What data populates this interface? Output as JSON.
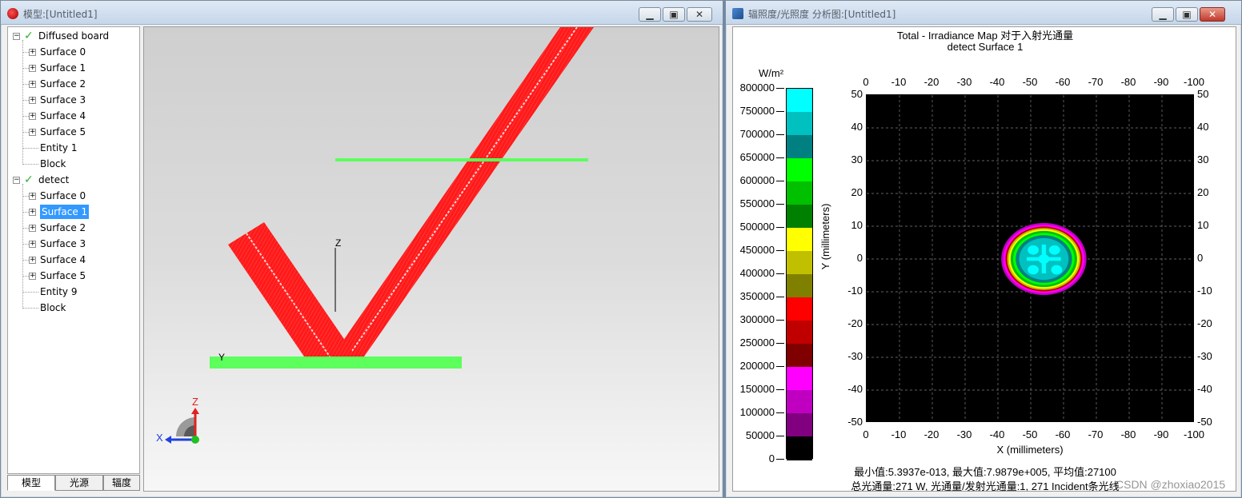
{
  "left_window": {
    "title": "模型:[Untitled1]",
    "tree": [
      {
        "label": "Diffused board",
        "level": 0,
        "checked": true
      },
      {
        "label": "Surface 0",
        "level": 1
      },
      {
        "label": "Surface 1",
        "level": 1
      },
      {
        "label": "Surface 2",
        "level": 1
      },
      {
        "label": "Surface 3",
        "level": 1
      },
      {
        "label": "Surface 4",
        "level": 1
      },
      {
        "label": "Surface 5",
        "level": 1
      },
      {
        "label": "Entity 1",
        "level": 1,
        "leaf": true
      },
      {
        "label": "Block",
        "level": 1,
        "leaf": true
      },
      {
        "label": "detect",
        "level": 0,
        "checked": true
      },
      {
        "label": "Surface 0",
        "level": 1
      },
      {
        "label": "Surface 1",
        "level": 1,
        "selected": true
      },
      {
        "label": "Surface 2",
        "level": 1
      },
      {
        "label": "Surface 3",
        "level": 1
      },
      {
        "label": "Surface 4",
        "level": 1
      },
      {
        "label": "Surface 5",
        "level": 1
      },
      {
        "label": "Entity 9",
        "level": 1,
        "leaf": true
      },
      {
        "label": "Block",
        "level": 1,
        "leaf": true
      }
    ],
    "tabs": [
      "模型",
      "光源",
      "辐度"
    ],
    "viewport": {
      "axis_z": "Z",
      "axis_y": "Y",
      "triad_z": "Z",
      "triad_x": "X",
      "ray_color": "#ff1a1a",
      "surface_color": "#5cff5c"
    }
  },
  "right_window": {
    "title": "辐照度/光照度 分析图:[Untitled1]",
    "plot_title_line1": "Total - Irradiance Map 对于入射光通量",
    "plot_title_line2": "detect Surface 1",
    "colorbar": {
      "unit": "W/m²",
      "tick_labels": [
        "800000",
        "750000",
        "700000",
        "650000",
        "600000",
        "550000",
        "500000",
        "450000",
        "400000",
        "350000",
        "300000",
        "250000",
        "200000",
        "150000",
        "100000",
        "50000",
        "0"
      ],
      "colors": [
        "#00ffff",
        "#00c0c0",
        "#008080",
        "#00ff00",
        "#00c000",
        "#008000",
        "#ffff00",
        "#c0c000",
        "#808000",
        "#ff0000",
        "#c00000",
        "#800000",
        "#ff00ff",
        "#c000c0",
        "#800080",
        "#000000"
      ]
    },
    "x_ticks": [
      "0",
      "-10",
      "-20",
      "-30",
      "-40",
      "-50",
      "-60",
      "-70",
      "-80",
      "-90",
      "-100"
    ],
    "y_ticks_left": [
      "50",
      "40",
      "30",
      "20",
      "10",
      "0",
      "-10",
      "-20",
      "-30",
      "-40",
      "-50"
    ],
    "y_ticks_right": [
      "50",
      "40",
      "30",
      "20",
      "10",
      "0",
      "-10",
      "-20",
      "-30",
      "-40",
      "-50"
    ],
    "x_label": "X (millimeters)",
    "y_label": "Y (millimeters)",
    "stats_line1": "最小值:5.3937e-013, 最大值:7.9879e+005, 平均值:27100",
    "stats_line2": "总光通量:271 W, 光通量/发射光通量:1, 271 Incident条光线",
    "watermark": "CSDN @zhoxiao2015"
  },
  "chart_data": {
    "type": "heatmap",
    "title": "Total - Irradiance Map 对于入射光通量",
    "subtitle": "detect Surface 1",
    "xlabel": "X (millimeters)",
    "ylabel": "Y (millimeters)",
    "xlim": [
      0,
      -100
    ],
    "ylim": [
      -50,
      50
    ],
    "colorbar_unit": "W/m²",
    "colorbar_range": [
      0,
      800000
    ],
    "spot_center": [
      -54,
      0
    ],
    "spot_radius_x": 13,
    "spot_radius_y": 11,
    "min": "5.3937e-013",
    "max": "7.9879e+005",
    "mean": "27100",
    "grid": true,
    "background_value": 0
  }
}
